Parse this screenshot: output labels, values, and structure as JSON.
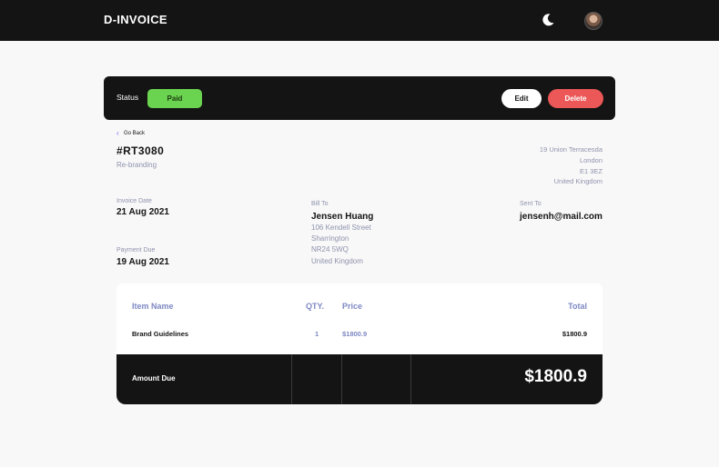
{
  "header": {
    "brand": "D-INVOICE",
    "theme_icon": "moon-icon",
    "avatar_icon": "avatar"
  },
  "status_bar": {
    "label": "Status",
    "status": "Paid",
    "status_color": "#6ad34f",
    "edit_label": "Edit",
    "delete_label": "Delete",
    "delete_color": "#ec5757"
  },
  "nav": {
    "go_back": "Go Back"
  },
  "invoice": {
    "id": "#RT3080",
    "description": "Re-branding",
    "sender_address": [
      "19 Union Terracesda",
      "London",
      "E1 3EZ",
      "United Kingdom"
    ],
    "invoice_date_label": "Invoice Date",
    "invoice_date": "21 Aug 2021",
    "payment_due_label": "Payment Due",
    "payment_due": "19 Aug 2021",
    "bill_to_label": "Bill To",
    "client_name": "Jensen Huang",
    "client_address": [
      "106 Kendell Street",
      "Sharrington",
      "NR24 5WQ",
      "United Kingdom"
    ],
    "sent_to_label": "Sent To",
    "client_email": "jensenh@mail.com"
  },
  "items_table": {
    "headers": {
      "name": "Item Name",
      "qty": "QTY.",
      "price": "Price",
      "total": "Total"
    },
    "rows": [
      {
        "name": "Brand Guidelines",
        "qty": "1",
        "price": "$1800.9",
        "total": "$1800.9"
      }
    ]
  },
  "amount_due": {
    "label": "Amount Due",
    "value": "$1800.9"
  }
}
